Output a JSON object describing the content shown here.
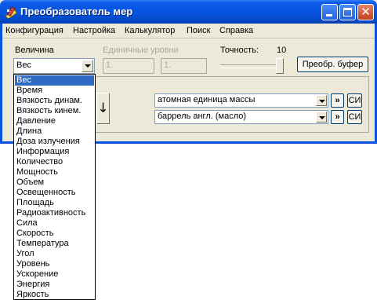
{
  "window": {
    "title": "Преобразователь мер",
    "close_glyph": "✕"
  },
  "menu": [
    "Конфигурация",
    "Настройка",
    "Калькулятор",
    "Поиск",
    "Справка"
  ],
  "toolbar": {
    "quantity_label": "Величина",
    "quantity_value": "Вес",
    "unit_levels_label": "Единичные уровни",
    "unit_level_1": "1.",
    "unit_level_2": "1.",
    "precision_label": "Точность:",
    "precision_value": "10",
    "convert_buffer_button": "Преобр. буфер"
  },
  "converter": {
    "swap_glyph": "↓",
    "from_unit": "атомная единица массы",
    "to_unit": "баррель англ. (масло)",
    "arrow_button": "»",
    "si_button": "СИ"
  },
  "dropdown": {
    "selected": "Вес",
    "options": [
      "Вес",
      "Время",
      "Вязкость динам.",
      "Вязкость кинем.",
      "Давление",
      "Длина",
      "Доза излучения",
      "Информация",
      "Количество",
      "Мощность",
      "Объем",
      "Освещенность",
      "Площадь",
      "Радиоактивность",
      "Сила",
      "Скорость",
      "Температура",
      "Угол",
      "Уровень",
      "Ускорение",
      "Энергия",
      "Яркость"
    ]
  },
  "colors": {
    "titlebar": "#0654de",
    "window_face": "#ece9d8",
    "selection": "#316ac5",
    "close_button": "#c5421e"
  },
  "icons": {
    "app_icon": "ruler-pencil-icon",
    "minimize": "minimize-icon",
    "maximize": "maximize-icon",
    "close": "close-icon",
    "combo_arrow": "chevron-down-icon",
    "swap": "arrow-down-icon"
  }
}
